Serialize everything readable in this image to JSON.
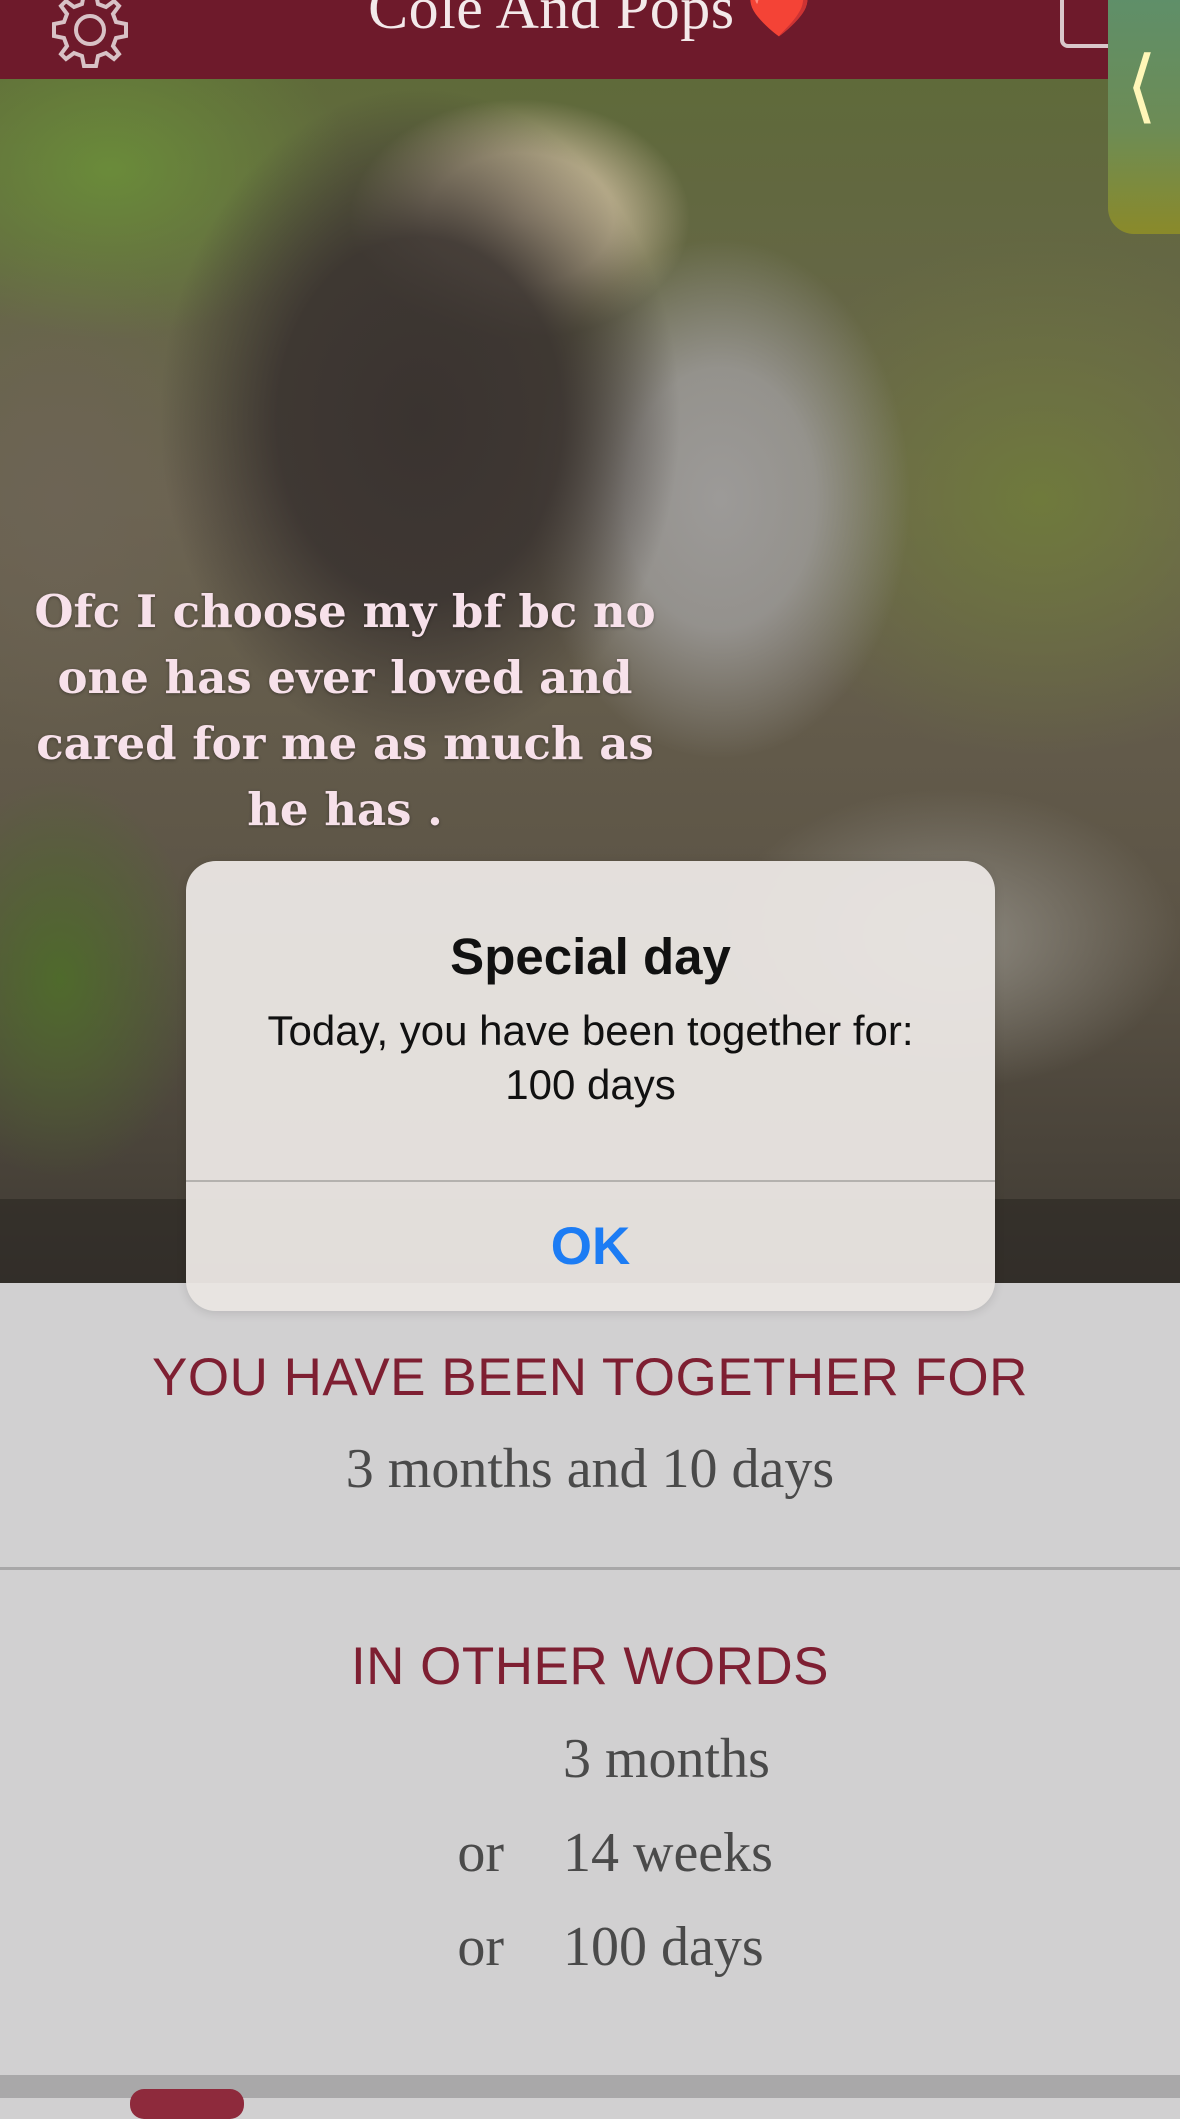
{
  "header": {
    "title": "Cole And Pops",
    "title_emoji": "❤️",
    "bg_color": "#6e1a2b",
    "settings_icon": "gear-icon",
    "share_icon": "share-icon"
  },
  "photo": {
    "caption": "Ofc I choose my bf bc no one has ever loved and cared for me as much as he has ."
  },
  "side_tab": {
    "icon": "chevron-left-icon",
    "glyph": "⟨"
  },
  "alert": {
    "title": "Special day",
    "message": "Today, you have been together for:\n100 days",
    "ok_label": "OK",
    "ok_color": "#1c7cf4"
  },
  "together": {
    "label": "YOU HAVE BEEN TOGETHER FOR",
    "value": "3 months and 10 days",
    "accent_color": "#7e1f32"
  },
  "other_words": {
    "label": "IN OTHER WORDS",
    "rows": [
      {
        "prefix": "",
        "value": "3 months"
      },
      {
        "prefix": "or",
        "value": "14 weeks"
      },
      {
        "prefix": "or",
        "value": "100 days"
      }
    ]
  }
}
